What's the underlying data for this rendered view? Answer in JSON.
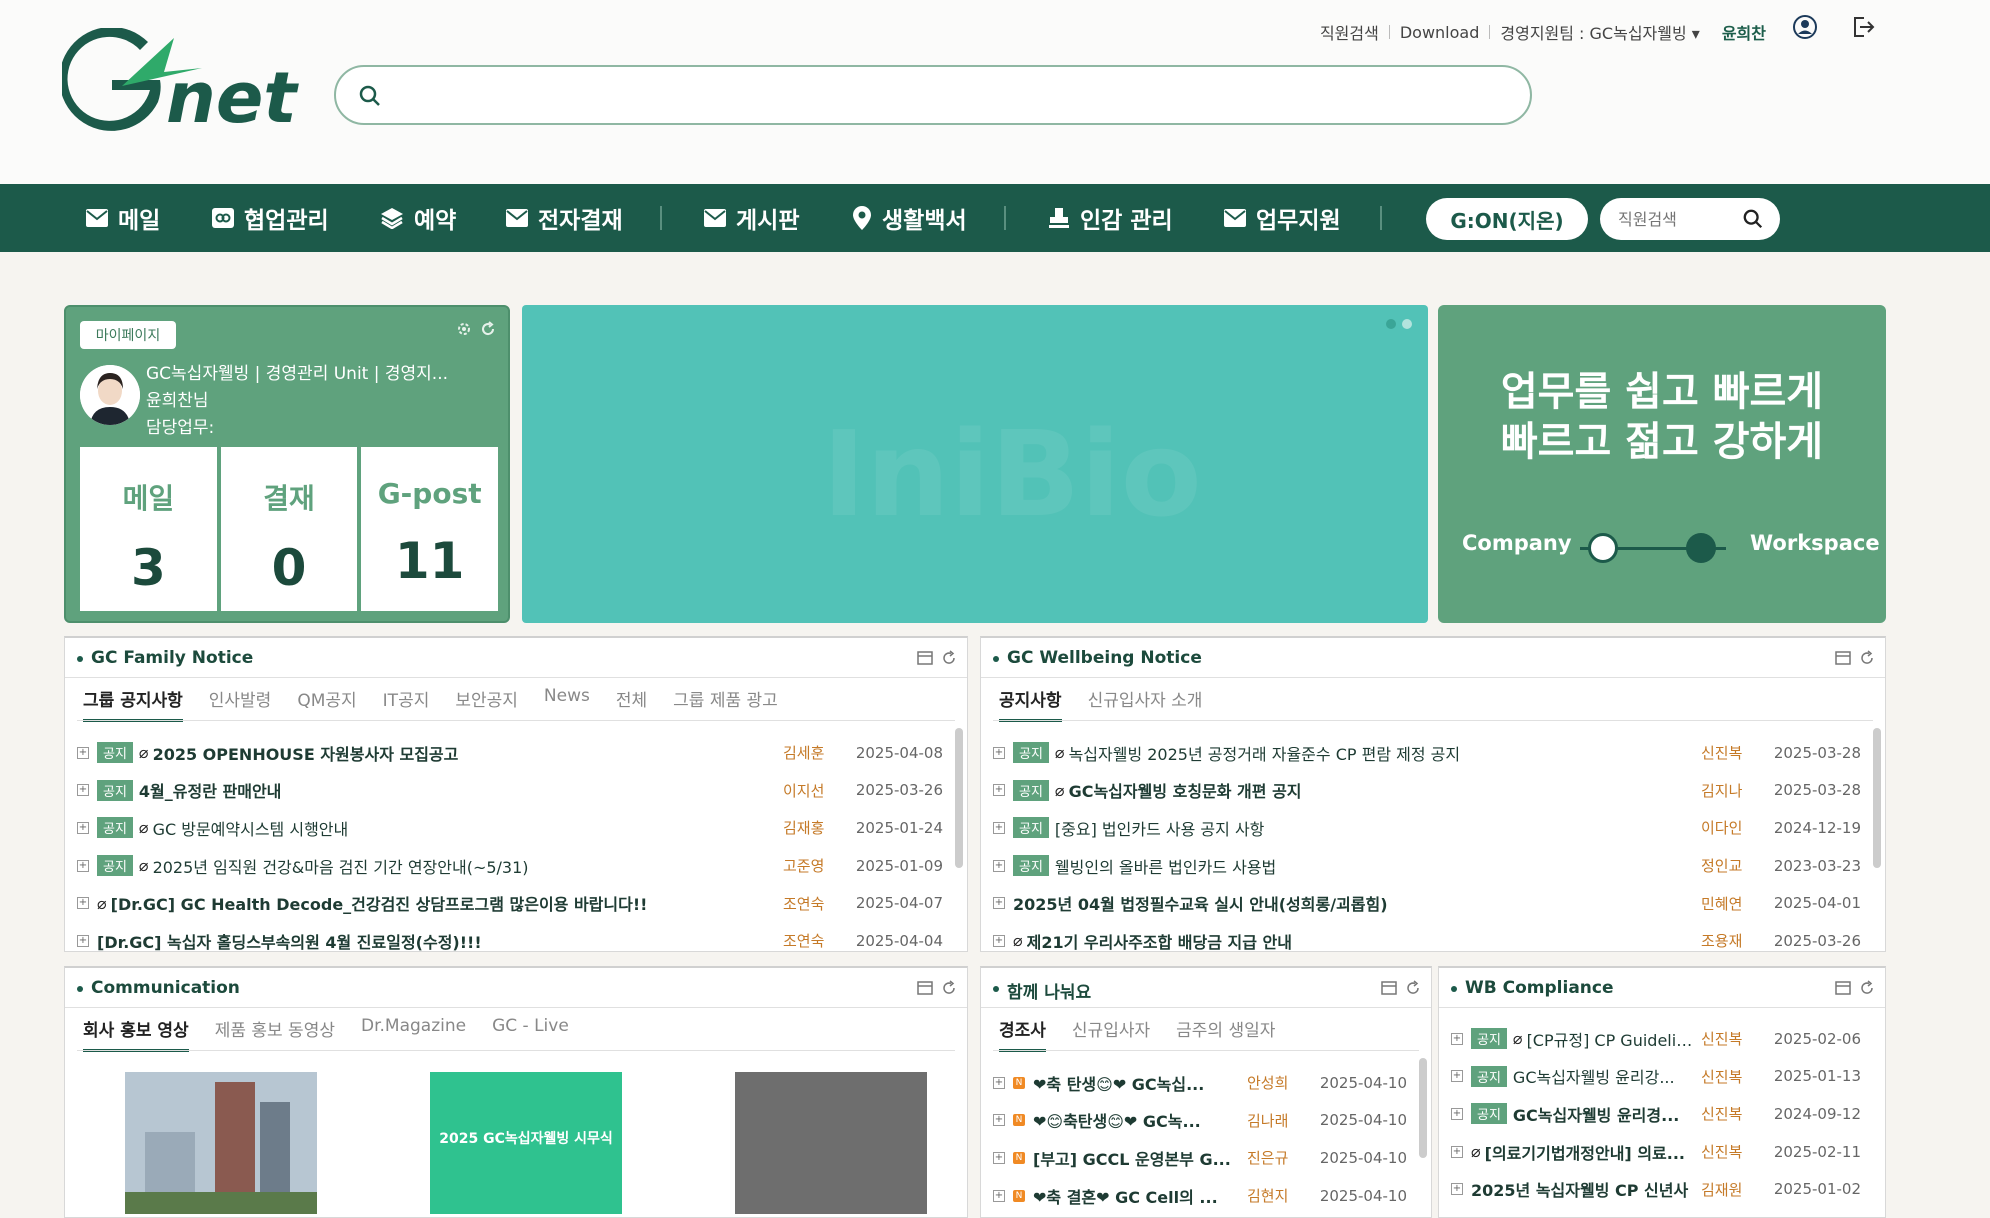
{
  "header": {
    "top_links": [
      "직원검색",
      "Download",
      "경영지원팀 : GC녹십자웰빙 ▾"
    ],
    "user_name": "윤희찬",
    "search_placeholder": ""
  },
  "nav": {
    "items": [
      "메일",
      "협업관리",
      "예약",
      "전자결재",
      "게시판",
      "생활백서",
      "인감 관리",
      "업무지원"
    ],
    "gon_label": "G:ON(지온)",
    "search_placeholder": "직원검색"
  },
  "mypage": {
    "tab_label": "마이페이지",
    "org": "GC녹십자웰빙 | 경영관리 Unit | 경영지...",
    "name": "윤희찬님",
    "duty": "담당업무:",
    "stats": [
      {
        "label": "메일",
        "value": "3"
      },
      {
        "label": "결재",
        "value": "0"
      },
      {
        "label": "G-post",
        "value": "11"
      }
    ]
  },
  "banner": {
    "watermark": "IniBio"
  },
  "workspace": {
    "title_line1": "업무를 쉽고 빠르게",
    "title_line2": "빠르고 젊고 강하게",
    "left_label": "Company",
    "right_label": "Workspace"
  },
  "family_notice": {
    "title": "GC Family Notice",
    "tabs": [
      "그룹 공지사항",
      "인사발령",
      "QM공지",
      "IT공지",
      "보안공지",
      "News",
      "전체",
      "그룹 제품 광고"
    ],
    "rows": [
      {
        "badge": "공지",
        "title": "2025 OPENHOUSE 자원봉사자 모집공고",
        "author": "김세훈",
        "date": "2025-04-08"
      },
      {
        "badge": "공지",
        "title": "4월_유정란 판매안내",
        "author": "이지선",
        "date": "2025-03-26"
      },
      {
        "badge": "공지",
        "title": "GC 방문예약시스템 시행안내",
        "author": "김재홍",
        "date": "2025-01-24"
      },
      {
        "badge": "공지",
        "title": "2025년 임직원 건강&마음 검진 기간 연장안내(~5/31)",
        "author": "고준영",
        "date": "2025-01-09"
      },
      {
        "badge": "",
        "title": "[Dr.GC] GC Health Decode_건강검진 상담프로그램 많은이용 바랍니다!!",
        "author": "조연숙",
        "date": "2025-04-07"
      },
      {
        "badge": "",
        "title": "[Dr.GC] 녹십자 홀딩스부속의원 4월 진료일정(수정)!!!",
        "author": "조연숙",
        "date": "2025-04-04"
      }
    ]
  },
  "wellbeing_notice": {
    "title": "GC Wellbeing Notice",
    "tabs": [
      "공지사항",
      "신규입사자 소개"
    ],
    "rows": [
      {
        "badge": "공지",
        "title": "녹십자웰빙 2025년 공정거래 자율준수 CP 편람 제정 공지",
        "author": "신진복",
        "date": "2025-03-28"
      },
      {
        "badge": "공지",
        "title": "GC녹십자웰빙 호칭문화 개편 공지",
        "author": "김지나",
        "date": "2025-03-28"
      },
      {
        "badge": "공지",
        "title": "[중요] 법인카드 사용 공지 사항",
        "author": "이다인",
        "date": "2024-12-19"
      },
      {
        "badge": "공지",
        "title": "웰빙인의 올바른 법인카드 사용법",
        "author": "정인교",
        "date": "2023-03-23"
      },
      {
        "badge": "",
        "title": "2025년 04월 법정필수교육 실시 안내(성희롱/괴롭힘)",
        "author": "민혜연",
        "date": "2025-04-01"
      },
      {
        "badge": "",
        "title": "제21기 우리사주조합 배당금 지급 안내",
        "author": "조용재",
        "date": "2025-03-26"
      }
    ]
  },
  "communication": {
    "title": "Communication",
    "tabs": [
      "회사 홍보 영상",
      "제품 홍보 동영상",
      "Dr.Magazine",
      "GC - Live"
    ],
    "thumbs": [
      {
        "caption": "",
        "color": "#8aa0b2"
      },
      {
        "caption": "2025 GC녹십자웰빙 시무식",
        "color": "#2fc28f"
      },
      {
        "caption": "",
        "color": "#6e6e6e"
      }
    ]
  },
  "share": {
    "title": "함께 나눠요",
    "tabs": [
      "경조사",
      "신규입사자",
      "금주의 생일자"
    ],
    "rows": [
      {
        "title": "❤축 탄생😊❤ GC녹십...",
        "author": "안성희",
        "date": "2025-04-10"
      },
      {
        "title": "❤😊축탄생😊❤ GC녹...",
        "author": "김나래",
        "date": "2025-04-10"
      },
      {
        "title": "[부고] GCCL 운영본부 G...",
        "author": "진은규",
        "date": "2025-04-10"
      },
      {
        "title": "❤축 결혼❤ GC Cell의 ...",
        "author": "김현지",
        "date": "2025-04-10"
      }
    ]
  },
  "wb_compliance": {
    "title": "WB Compliance",
    "rows": [
      {
        "badge": "공지",
        "title": "[CP규정] CP Guidelin...",
        "author": "신진복",
        "date": "2025-02-06"
      },
      {
        "badge": "공지",
        "title": "GC녹십자웰빙 윤리강...",
        "author": "신진복",
        "date": "2025-01-13"
      },
      {
        "badge": "공지",
        "title": "GC녹십자웰빙 윤리경...",
        "author": "신진복",
        "date": "2024-09-12"
      },
      {
        "badge": "",
        "title": "[의료기기법개정안내] 의료...",
        "author": "신진복",
        "date": "2025-02-11"
      },
      {
        "badge": "",
        "title": "2025년 녹십자웰빙 CP 신년사",
        "author": "김재원",
        "date": "2025-01-02"
      }
    ]
  },
  "colors": {
    "brand_dark": "#1c5a4a",
    "brand_green": "#5fa27d",
    "banner_teal": "#52c2b7"
  }
}
